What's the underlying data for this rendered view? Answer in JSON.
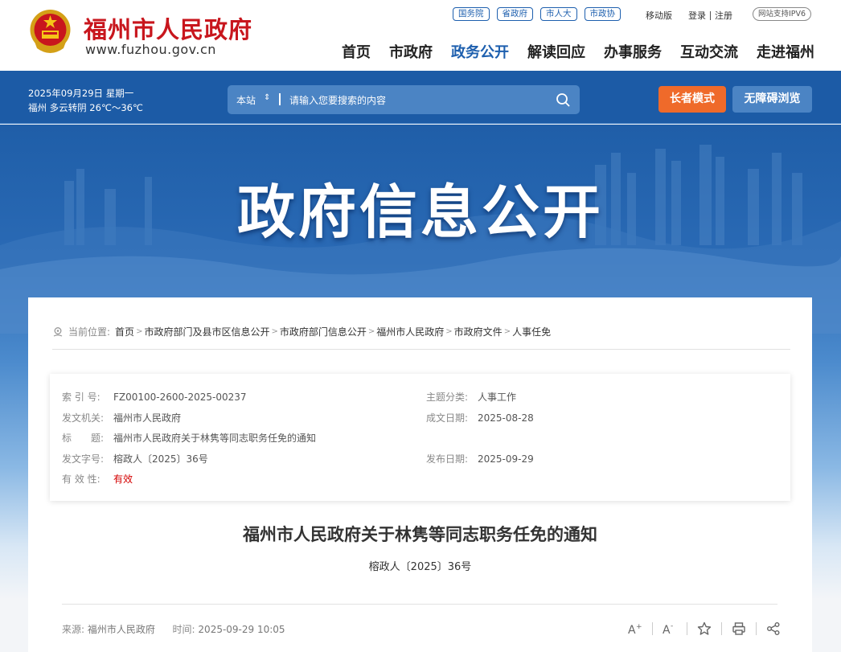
{
  "site": {
    "name": "福州市人民政府",
    "url": "www.fuzhou.gov.cn"
  },
  "toplinks": [
    "国务院",
    "省政府",
    "市人大",
    "市政协"
  ],
  "util": {
    "mobile": "移动版",
    "login": "登录",
    "register": "注册",
    "ipv6": "网站支持IPV6"
  },
  "nav": [
    "首页",
    "市政府",
    "政务公开",
    "解读回应",
    "办事服务",
    "互动交流",
    "走进福州"
  ],
  "nav_active": "政务公开",
  "date": {
    "line1": "2025年09月29日 星期一",
    "line2": "福州 多云转阴 26℃～36℃"
  },
  "search": {
    "scope": "本站",
    "placeholder": "请输入您要搜索的内容"
  },
  "buttons": {
    "elder": "长者模式",
    "access": "无障碍浏览"
  },
  "banner": {
    "title": "政府信息公开"
  },
  "breadcrumb": {
    "label": "当前位置:",
    "items": [
      "首页",
      "市政府部门及县市区信息公开",
      "市政府部门信息公开",
      "福州市人民政府",
      "市政府文件",
      "人事任免"
    ]
  },
  "meta": {
    "index_label": "索 引 号:",
    "index": "FZ00100-2600-2025-00237",
    "topic_label": "主题分类:",
    "topic": "人事工作",
    "issuer_label": "发文机关:",
    "issuer": "福州市人民政府",
    "date_label": "成文日期:",
    "date": "2025-08-28",
    "title_label": "标　　题:",
    "title": "福州市人民政府关于林隽等同志职务任免的通知",
    "docno_label": "发文字号:",
    "docno": "榕政人〔2025〕36号",
    "pubdate_label": "发布日期:",
    "pubdate": "2025-09-29",
    "valid_label": "有 效 性:",
    "valid": "有效"
  },
  "doc": {
    "title": "福州市人民政府关于林隽等同志职务任免的通知",
    "number": "榕政人〔2025〕36号",
    "source_label": "来源:",
    "source": "福州市人民政府",
    "time_label": "时间:",
    "time": "2025-09-29 10:05"
  },
  "colors": {
    "brand_red": "#c8161d",
    "brand_blue": "#1d5fae",
    "elder_orange": "#ef6a2a"
  }
}
